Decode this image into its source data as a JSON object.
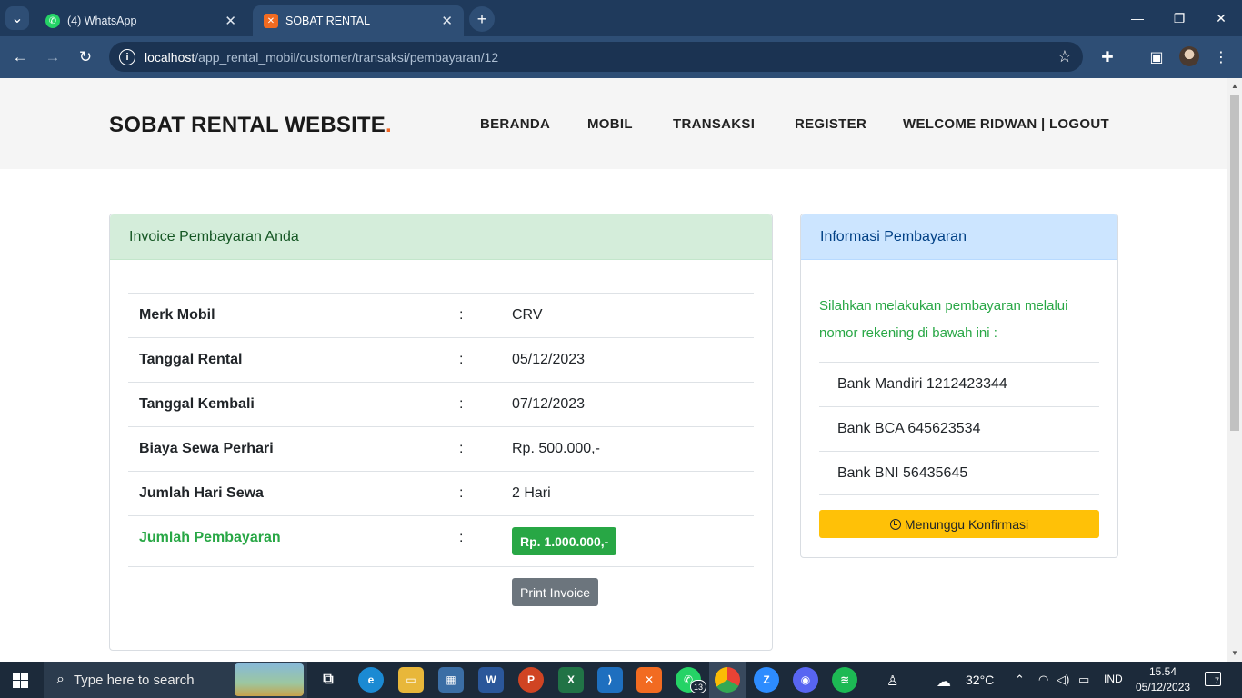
{
  "browser": {
    "tabs": [
      {
        "title": "(4) WhatsApp",
        "active": false
      },
      {
        "title": "SOBAT RENTAL",
        "active": true
      }
    ],
    "url_host": "localhost",
    "url_path": "/app_rental_mobil/customer/transaksi/pembayaran/12"
  },
  "site": {
    "brand": "SOBAT RENTAL WEBSITE",
    "brand_dot": ".",
    "nav": [
      "BERANDA",
      "MOBIL",
      "TRANSAKSI",
      "REGISTER",
      "WELCOME RIDWAN | LOGOUT"
    ]
  },
  "invoice": {
    "title": "Invoice Pembayaran Anda",
    "rows": [
      {
        "label": "Merk Mobil",
        "value": "CRV"
      },
      {
        "label": "Tanggal Rental",
        "value": "05/12/2023"
      },
      {
        "label": "Tanggal Kembali",
        "value": "07/12/2023"
      },
      {
        "label": "Biaya Sewa Perhari",
        "value": "Rp. 500.000,-"
      },
      {
        "label": "Jumlah Hari Sewa",
        "value": "2 Hari"
      }
    ],
    "separator": ":",
    "total_label": "Jumlah Pembayaran",
    "total_value": "Rp. 1.000.000,-",
    "print_label": "Print Invoice"
  },
  "payment_info": {
    "title": "Informasi Pembayaran",
    "instruction": "Silahkan melakukan pembayaran melalui nomor rekening di bawah ini :",
    "banks": [
      "Bank Mandiri 1212423344",
      "Bank BCA 645623534",
      "Bank BNI 56435645"
    ],
    "status_label": "Menunggu Konfirmasi"
  },
  "taskbar": {
    "search_placeholder": "Type here to search",
    "weather": "32°C",
    "language": "IND",
    "time": "15.54",
    "date": "05/12/2023",
    "whatsapp_badge": "13",
    "notification_count": "7"
  },
  "colors": {
    "success": "#28a745",
    "warning": "#ffc107",
    "secondary": "#6c757d",
    "brand_accent": "#f26522"
  }
}
